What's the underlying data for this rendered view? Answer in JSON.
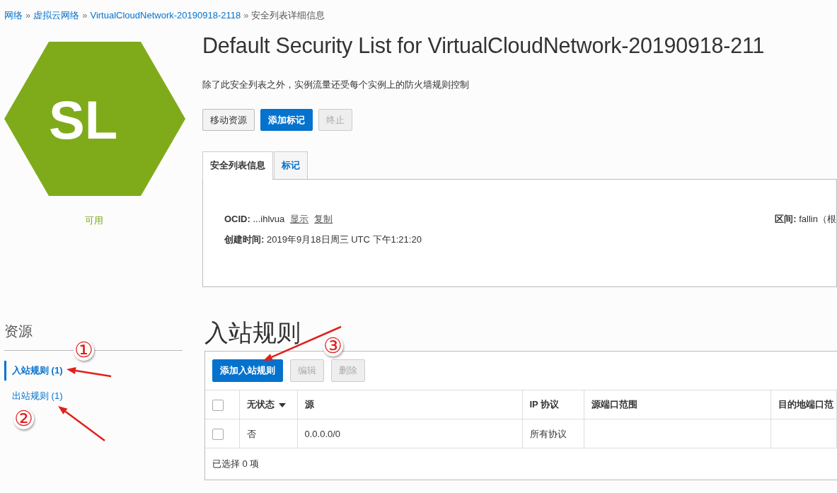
{
  "breadcrumb": [
    {
      "label": "网络",
      "link": true
    },
    {
      "separator": "»",
      "label": "虚拟云网络",
      "link": true
    },
    {
      "separator": "»",
      "label": "VirtualCloudNetwork-20190918-2118",
      "link": true
    },
    {
      "separator": "»",
      "label": "安全列表详细信息",
      "link": false
    }
  ],
  "resource": {
    "badge": "SL",
    "status": "可用"
  },
  "title": "Default Security List for VirtualCloudNetwork-20190918-211",
  "description": "除了此安全列表之外，实例流量还受每个实例上的防火墙规则控制",
  "actions": [
    {
      "label": "移动资源",
      "kind": "default",
      "disabled": false
    },
    {
      "label": "添加标记",
      "kind": "primary",
      "disabled": false
    },
    {
      "label": "终止",
      "kind": "default",
      "disabled": true
    }
  ],
  "tabs": [
    {
      "label": "安全列表信息",
      "selected": true
    },
    {
      "label": "标记",
      "selected": false
    }
  ],
  "details": {
    "ocid": {
      "label": "OCID:",
      "value": "...ihlvua",
      "links": [
        "显示",
        "复制"
      ]
    },
    "compartment": {
      "label": "区间:",
      "value": "fallin（根"
    },
    "created": {
      "label": "创建时间:",
      "value": "2019年9月18日周三 UTC 下午1:21:20"
    }
  },
  "resources": {
    "title": "资源",
    "items": [
      {
        "label": "入站规则 (1)",
        "selected": true
      },
      {
        "label": "出站规则 (1)",
        "selected": false
      }
    ]
  },
  "section_title": "入站规则",
  "table": {
    "toolbar": [
      {
        "label": "添加入站规则",
        "kind": "primary",
        "disabled": false
      },
      {
        "label": "编辑",
        "kind": "default",
        "disabled": true
      },
      {
        "label": "删除",
        "kind": "default",
        "disabled": true
      }
    ],
    "select_all_checked": false,
    "columns": [
      {
        "label": "无状态",
        "sortable": true
      },
      {
        "label": "源",
        "sortable": false
      },
      {
        "label": "IP 协议",
        "sortable": false
      },
      {
        "label": "源端口范围",
        "sortable": false
      },
      {
        "label": "目的地端口范",
        "sortable": false
      }
    ],
    "rows": [
      {
        "checked": false,
        "cells": [
          "否",
          "0.0.0.0/0",
          "所有协议"
        ]
      }
    ],
    "footer": "已选择 0 项"
  },
  "annotations": [
    {
      "label": "①"
    },
    {
      "label": "②"
    },
    {
      "label": "③"
    }
  ]
}
